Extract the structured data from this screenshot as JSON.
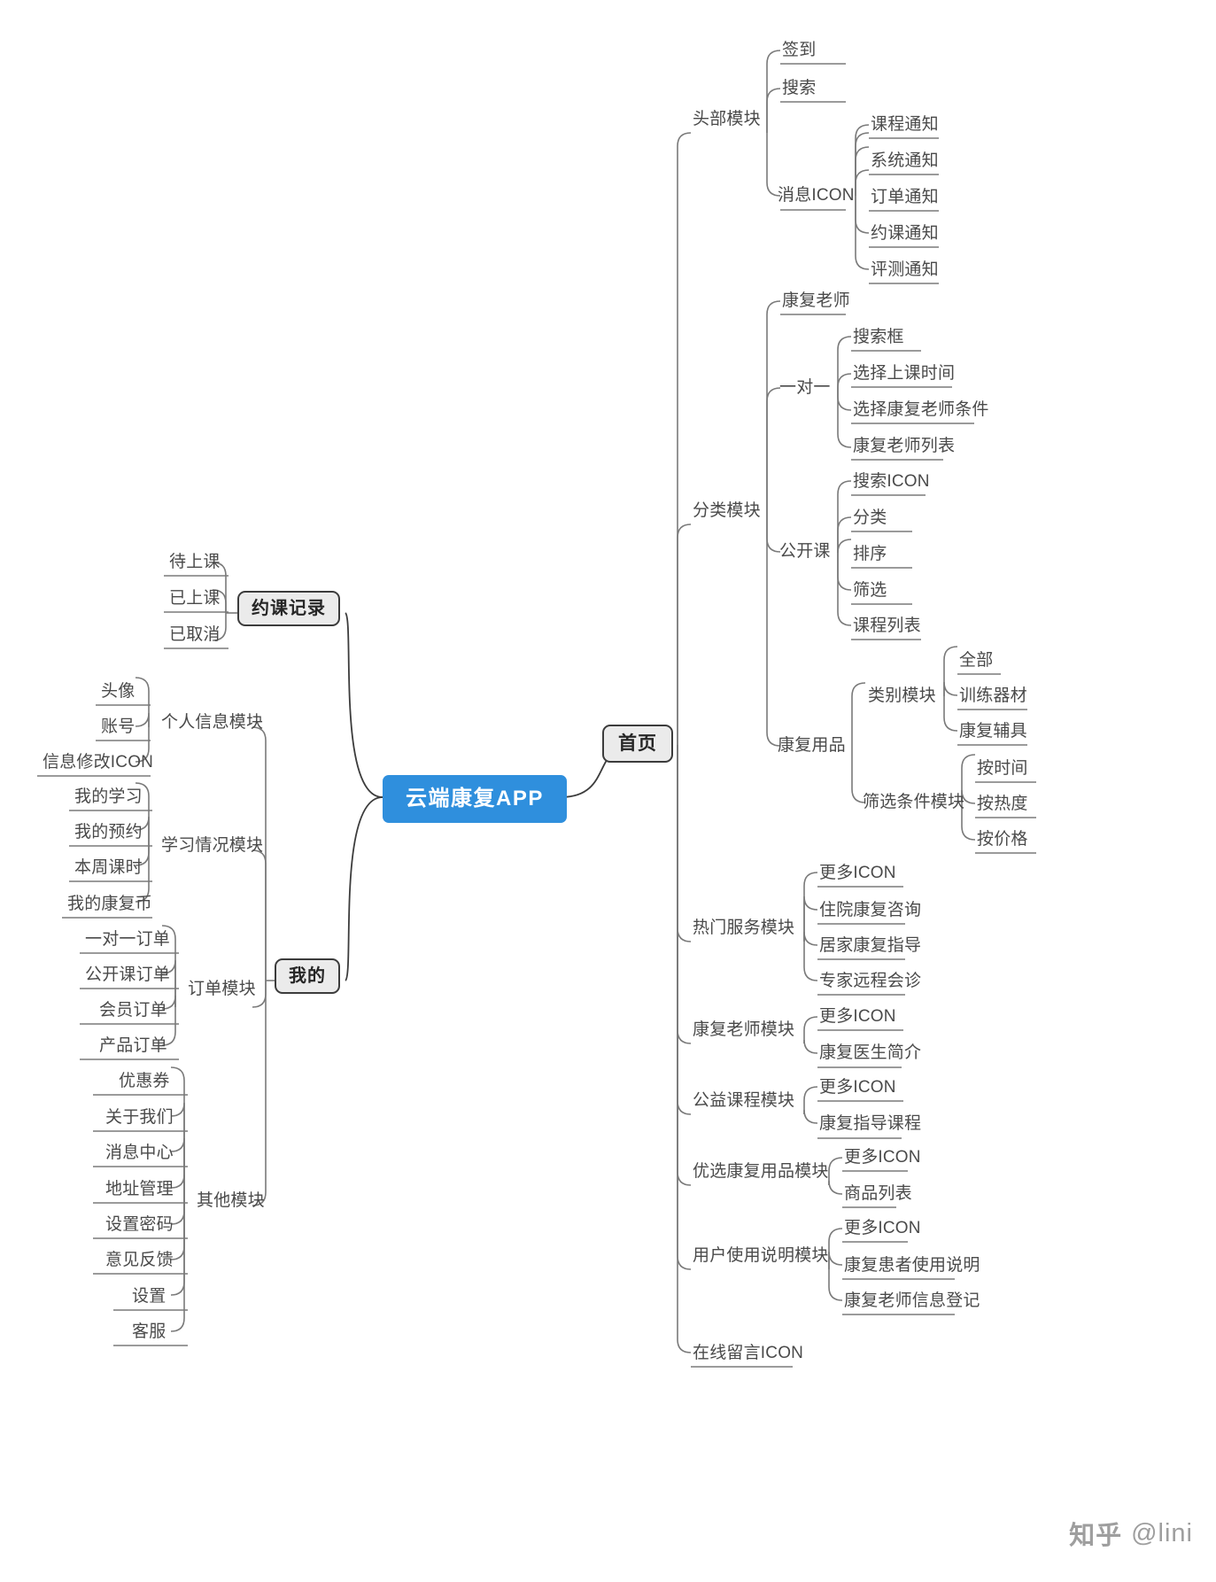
{
  "root": {
    "label": "云端康复APP",
    "color": "#2f8fdd"
  },
  "watermark": {
    "logo": "知乎",
    "handle": "@lini"
  },
  "colors": {
    "root_bg": "#2f8fdd",
    "box_bg": "#ebebeb",
    "box_border": "#3c3c3c",
    "line": "#7a7a7a",
    "text": "#4a4a4a"
  },
  "branches": {
    "home": {
      "label": "首页",
      "modules": [
        {
          "label": "头部模块",
          "children": [
            {
              "label": "签到"
            },
            {
              "label": "搜索"
            },
            {
              "label": "消息ICON",
              "children": [
                {
                  "label": "课程通知"
                },
                {
                  "label": "系统通知"
                },
                {
                  "label": "订单通知"
                },
                {
                  "label": "约课通知"
                },
                {
                  "label": "评测通知"
                }
              ]
            }
          ]
        },
        {
          "label": "分类模块",
          "children": [
            {
              "label": "康复老师"
            },
            {
              "label": "一对一",
              "children": [
                {
                  "label": "搜索框"
                },
                {
                  "label": "选择上课时间"
                },
                {
                  "label": "选择康复老师条件"
                },
                {
                  "label": "康复老师列表"
                }
              ]
            },
            {
              "label": "公开课",
              "children": [
                {
                  "label": "搜索ICON"
                },
                {
                  "label": "分类"
                },
                {
                  "label": "排序"
                },
                {
                  "label": "筛选"
                },
                {
                  "label": "课程列表"
                }
              ]
            },
            {
              "label": "康复用品",
              "children": [
                {
                  "label": "类别模块",
                  "children": [
                    {
                      "label": "全部"
                    },
                    {
                      "label": "训练器材"
                    },
                    {
                      "label": "康复辅具"
                    }
                  ]
                },
                {
                  "label": "筛选条件模块",
                  "children": [
                    {
                      "label": "按时间"
                    },
                    {
                      "label": "按热度"
                    },
                    {
                      "label": "按价格"
                    }
                  ]
                }
              ]
            }
          ]
        },
        {
          "label": "热门服务模块",
          "children": [
            {
              "label": "更多ICON"
            },
            {
              "label": "住院康复咨询"
            },
            {
              "label": "居家康复指导"
            },
            {
              "label": "专家远程会诊"
            }
          ]
        },
        {
          "label": "康复老师模块",
          "children": [
            {
              "label": "更多ICON"
            },
            {
              "label": "康复医生简介"
            }
          ]
        },
        {
          "label": "公益课程模块",
          "children": [
            {
              "label": "更多ICON"
            },
            {
              "label": "康复指导课程"
            }
          ]
        },
        {
          "label": "优选康复用品模块",
          "children": [
            {
              "label": "更多ICON"
            },
            {
              "label": "商品列表"
            }
          ]
        },
        {
          "label": "用户使用说明模块",
          "children": [
            {
              "label": "更多ICON"
            },
            {
              "label": "康复患者使用说明"
            },
            {
              "label": "康复老师信息登记"
            }
          ]
        },
        {
          "label": "在线留言ICON",
          "children": []
        }
      ]
    },
    "booking": {
      "label": "约课记录",
      "children": [
        {
          "label": "待上课"
        },
        {
          "label": "已上课"
        },
        {
          "label": "已取消"
        }
      ]
    },
    "mine": {
      "label": "我的",
      "modules": [
        {
          "label": "个人信息模块",
          "children": [
            {
              "label": "头像"
            },
            {
              "label": "账号"
            },
            {
              "label": "信息修改ICON"
            }
          ]
        },
        {
          "label": "学习情况模块",
          "children": [
            {
              "label": "我的学习"
            },
            {
              "label": "我的预约"
            },
            {
              "label": "本周课时"
            },
            {
              "label": "我的康复币"
            }
          ]
        },
        {
          "label": "订单模块",
          "children": [
            {
              "label": "一对一订单"
            },
            {
              "label": "公开课订单"
            },
            {
              "label": "会员订单"
            },
            {
              "label": "产品订单"
            }
          ]
        },
        {
          "label": "其他模块",
          "children": [
            {
              "label": "优惠券"
            },
            {
              "label": "关于我们"
            },
            {
              "label": "消息中心"
            },
            {
              "label": "地址管理"
            },
            {
              "label": "设置密码"
            },
            {
              "label": "意见反馈"
            },
            {
              "label": "设置"
            },
            {
              "label": "客服"
            }
          ]
        }
      ]
    }
  }
}
